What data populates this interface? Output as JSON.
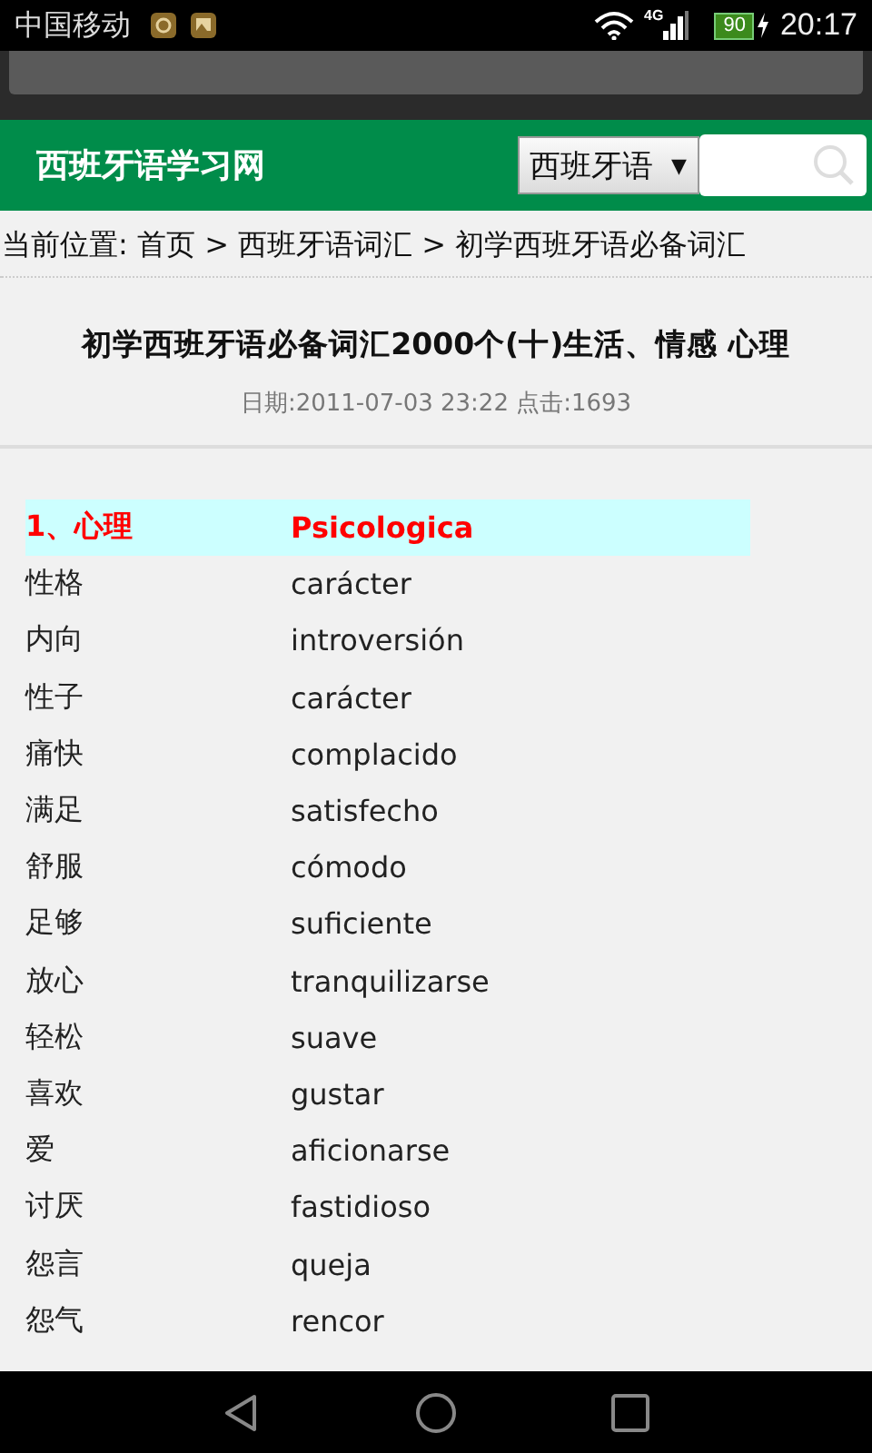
{
  "status_bar": {
    "carrier": "中国移动",
    "network": "4G",
    "battery": "90",
    "time": "20:17"
  },
  "header": {
    "site_title": "西班牙语学习网",
    "language_select": "西班牙语",
    "dropdown_arrow": "▼"
  },
  "breadcrumb": "当前位置: 首页 > 西班牙语词汇 > 初学西班牙语必备词汇",
  "article": {
    "title": "初学西班牙语必备词汇2000个(十)生活、情感 心理",
    "meta": "日期:2011-07-03 23:22  点击:1693"
  },
  "vocabulary": [
    {
      "kind": "heading",
      "chinese": "1、心理",
      "spanish": "Psicologica"
    },
    {
      "kind": "entry",
      "chinese": "性格",
      "spanish": "carácter"
    },
    {
      "kind": "entry",
      "chinese": "内向",
      "spanish": "introversión"
    },
    {
      "kind": "entry",
      "chinese": "性子",
      "spanish": "carácter"
    },
    {
      "kind": "entry",
      "chinese": "痛快",
      "spanish": "complacido"
    },
    {
      "kind": "entry",
      "chinese": "满足",
      "spanish": "satisfecho"
    },
    {
      "kind": "entry",
      "chinese": "舒服",
      "spanish": "cómodo"
    },
    {
      "kind": "entry",
      "chinese": "足够",
      "spanish": "suficiente"
    },
    {
      "kind": "entry",
      "chinese": "放心",
      "spanish": "tranquilizarse"
    },
    {
      "kind": "entry",
      "chinese": "轻松",
      "spanish": "suave"
    },
    {
      "kind": "entry",
      "chinese": "喜欢",
      "spanish": "gustar"
    },
    {
      "kind": "entry",
      "chinese": "爱",
      "spanish": "aficionarse"
    },
    {
      "kind": "entry",
      "chinese": "讨厌",
      "spanish": "fastidioso"
    },
    {
      "kind": "entry",
      "chinese": "怨言",
      "spanish": "queja"
    },
    {
      "kind": "entry",
      "chinese": "怨气",
      "spanish": "rencor"
    }
  ]
}
